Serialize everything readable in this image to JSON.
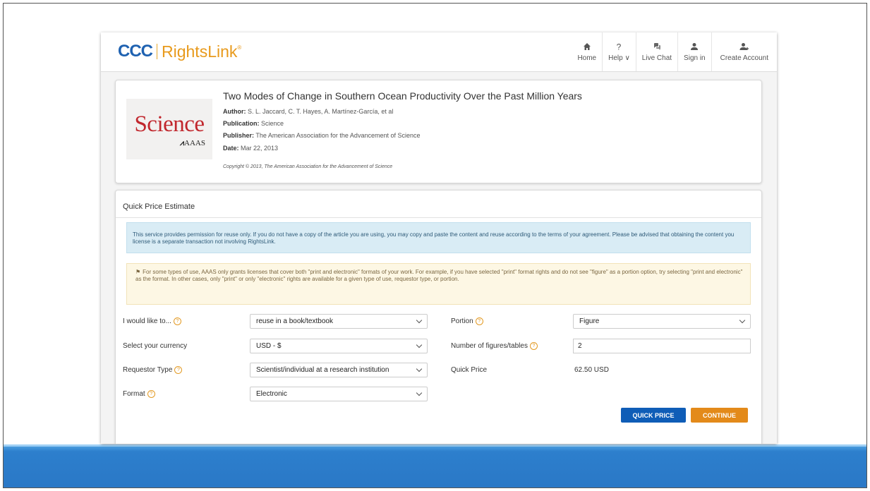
{
  "header": {
    "logo_primary": "CCC",
    "logo_secondary": "RightsLink",
    "logo_registered": "®",
    "nav": [
      {
        "label": "Home",
        "icon": "home-icon"
      },
      {
        "label": "Help ∨",
        "icon": "help-icon"
      },
      {
        "label": "Live Chat",
        "icon": "chat-icon"
      },
      {
        "label": "Sign in",
        "icon": "user-icon"
      },
      {
        "label": "Create Account",
        "icon": "add-user-icon"
      }
    ]
  },
  "article": {
    "publisher_logo_text": "Science",
    "publisher_logo_sub": "AAAS",
    "title": "Two Modes of Change in Southern Ocean Productivity Over the Past Million Years",
    "author_label": "Author:",
    "author": "S. L. Jaccard, C. T. Hayes, A. Martínez-García, et al",
    "publication_label": "Publication:",
    "publication": "Science",
    "publisher_label": "Publisher:",
    "publisher": "The American Association for the Advancement of Science",
    "date_label": "Date:",
    "date": "Mar 22, 2013",
    "copyright": "Copyright © 2013, The American Association for the Advancement of Science"
  },
  "quick_price": {
    "title": "Quick Price Estimate",
    "info_notice": "This service provides permission for reuse only. If you do not have a copy of the article you are using, you may copy and paste the content and reuse according to the terms of your agreement. Please be advised that obtaining the content you license is a separate transaction not involving RightsLink.",
    "warning_notice": "For some types of use, AAAS only grants licenses that cover both \"print and electronic\" formats of your work. For example, if you have selected \"print\" format rights and do not see \"figure\" as a portion option, try selecting \"print and electronic\" as the format. In other cases, only \"print\" or only \"electronic\" rights are available for a given type of use, requestor type, or portion.",
    "fields": {
      "would_like_label": "I would like to...",
      "would_like_value": "reuse in a book/textbook",
      "currency_label": "Select your currency",
      "currency_value": "USD - $",
      "requestor_label": "Requestor Type",
      "requestor_value": "Scientist/individual at a research institution",
      "format_label": "Format",
      "format_value": "Electronic",
      "portion_label": "Portion",
      "portion_value": "Figure",
      "num_figures_label": "Number of figures/tables",
      "num_figures_value": "2",
      "quick_price_label": "Quick Price",
      "quick_price_value": "62.50 USD"
    },
    "buttons": {
      "quick_price": "QUICK PRICE",
      "continue": "CONTINUE"
    }
  },
  "colors": {
    "brand_blue": "#1f62b1",
    "brand_orange": "#e89a1c",
    "button_blue": "#0f5db7",
    "button_orange": "#e38a1a",
    "slide_band": "#2a78c6"
  }
}
